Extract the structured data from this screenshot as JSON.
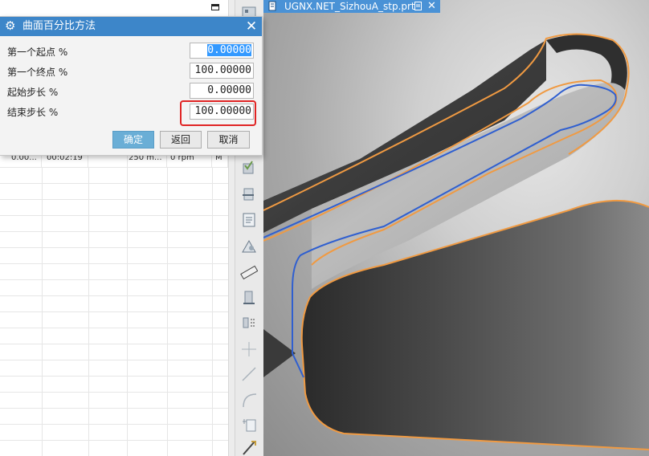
{
  "dialog": {
    "title": "曲面百分比方法",
    "fields": [
      {
        "label": "第一个起点 %",
        "value": "0.00000"
      },
      {
        "label": "第一个终点 %",
        "value": "100.00000"
      },
      {
        "label": "起始步长 %",
        "value": "0.00000"
      },
      {
        "label": "结束步长 %",
        "value": "100.00000"
      }
    ],
    "buttons": {
      "ok": "确定",
      "back": "返回",
      "cancel": "取消"
    }
  },
  "graphics_tab": {
    "title": "UGNX.NET_SizhouA_stp.prt",
    "close": "✕"
  },
  "navigator_row": {
    "cells": [
      "0.00...",
      "00:02:19",
      "250 m...",
      "0 rpm",
      "M"
    ]
  },
  "colors": {
    "titlebar": "#3d86c9",
    "tab": "#4a92d6",
    "orange_edge": "#f09a42",
    "blue_curve": "#2f5fd0",
    "highlight": "#e02424"
  },
  "icons": [
    "gear-icon",
    "close-icon",
    "maximize-icon",
    "file-icon",
    "doc-icon"
  ]
}
